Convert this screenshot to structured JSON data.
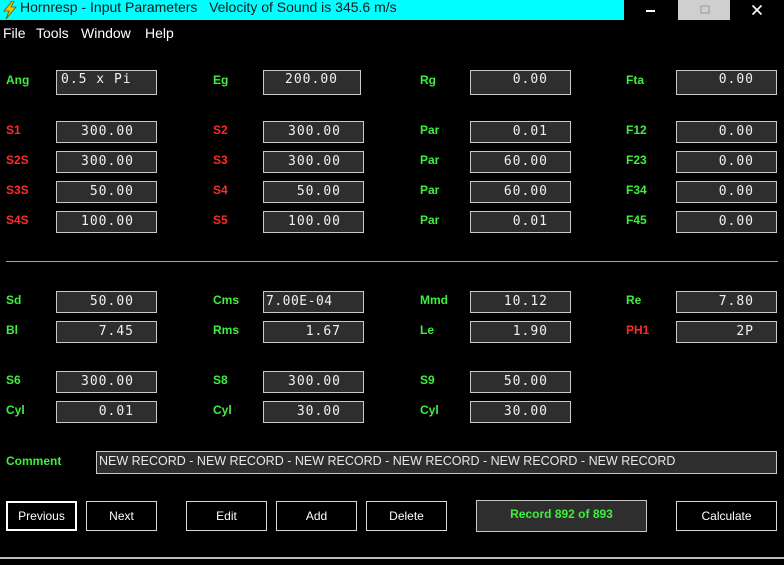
{
  "window": {
    "title": "Hornresp - Input Parameters",
    "subtitle": "Velocity of Sound is 345.6 m/s"
  },
  "menu": [
    "File",
    "Tools",
    "Window",
    "Help"
  ],
  "params": {
    "ang": {
      "label": "Ang",
      "value": "0.5 x Pi"
    },
    "eg": {
      "label": "Eg",
      "value": "200.00"
    },
    "rg": {
      "label": "Rg",
      "value": "0.00"
    },
    "fta": {
      "label": "Fta",
      "value": "0.00"
    },
    "s1": {
      "label": "S1",
      "value": "300.00"
    },
    "s2": {
      "label": "S2",
      "value": "300.00"
    },
    "par1": {
      "label": "Par",
      "value": "0.01"
    },
    "f12": {
      "label": "F12",
      "value": "0.00"
    },
    "s2s": {
      "label": "S2S",
      "value": "300.00"
    },
    "s3": {
      "label": "S3",
      "value": "300.00"
    },
    "par2": {
      "label": "Par",
      "value": "60.00"
    },
    "f23": {
      "label": "F23",
      "value": "0.00"
    },
    "s3s": {
      "label": "S3S",
      "value": "50.00"
    },
    "s4": {
      "label": "S4",
      "value": "50.00"
    },
    "par3": {
      "label": "Par",
      "value": "60.00"
    },
    "f34": {
      "label": "F34",
      "value": "0.00"
    },
    "s4s": {
      "label": "S4S",
      "value": "100.00"
    },
    "s5": {
      "label": "S5",
      "value": "100.00"
    },
    "par4": {
      "label": "Par",
      "value": "0.01"
    },
    "f45": {
      "label": "F45",
      "value": "0.00"
    },
    "sd": {
      "label": "Sd",
      "value": "50.00"
    },
    "cms": {
      "label": "Cms",
      "value": "7.00E-04"
    },
    "mmd": {
      "label": "Mmd",
      "value": "10.12"
    },
    "re": {
      "label": "Re",
      "value": "7.80"
    },
    "bl": {
      "label": "Bl",
      "value": "7.45"
    },
    "rms": {
      "label": "Rms",
      "value": "1.67"
    },
    "le": {
      "label": "Le",
      "value": "1.90"
    },
    "ph1": {
      "label": "PH1",
      "value": "2P"
    },
    "s6": {
      "label": "S6",
      "value": "300.00"
    },
    "s8": {
      "label": "S8",
      "value": "300.00"
    },
    "s9": {
      "label": "S9",
      "value": "50.00"
    },
    "cyl1": {
      "label": "Cyl",
      "value": "0.01"
    },
    "cyl2": {
      "label": "Cyl",
      "value": "30.00"
    },
    "cyl3": {
      "label": "Cyl",
      "value": "30.00"
    }
  },
  "comment": {
    "label": "Comment",
    "value": "NEW RECORD - NEW RECORD - NEW RECORD - NEW RECORD - NEW RECORD - NEW RECORD"
  },
  "buttons": {
    "previous": "Previous",
    "next": "Next",
    "edit": "Edit",
    "add": "Add",
    "delete": "Delete",
    "calculate": "Calculate"
  },
  "record": "Record 892 of 893",
  "colors": {
    "titlebar": "#00ffff",
    "label_green": "#3cf03c",
    "label_red": "#ff2a2a",
    "field_bg": "#2e2e2e"
  }
}
